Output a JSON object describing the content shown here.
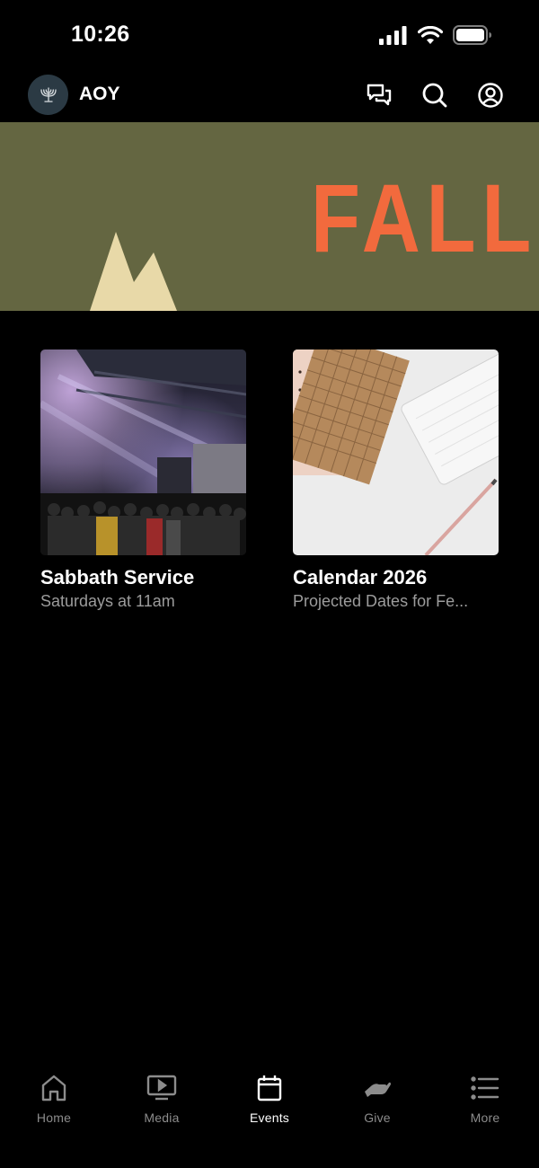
{
  "status_bar": {
    "time": "10:26"
  },
  "header": {
    "org_name": "AOY"
  },
  "banner": {
    "title": "FALL",
    "background": "#646641",
    "title_color": "#f26a3d",
    "mountain_color": "#e8d9a8"
  },
  "cards": [
    {
      "title": "Sabbath Service",
      "subtitle": "Saturdays at 11am"
    },
    {
      "title": "Calendar 2026",
      "subtitle": "Projected Dates for Fe..."
    }
  ],
  "tab_bar": {
    "active_index": 2,
    "tabs": [
      {
        "label": "Home",
        "icon": "home-icon"
      },
      {
        "label": "Media",
        "icon": "media-icon"
      },
      {
        "label": "Events",
        "icon": "calendar-icon"
      },
      {
        "label": "Give",
        "icon": "give-icon"
      },
      {
        "label": "More",
        "icon": "list-icon"
      }
    ]
  }
}
